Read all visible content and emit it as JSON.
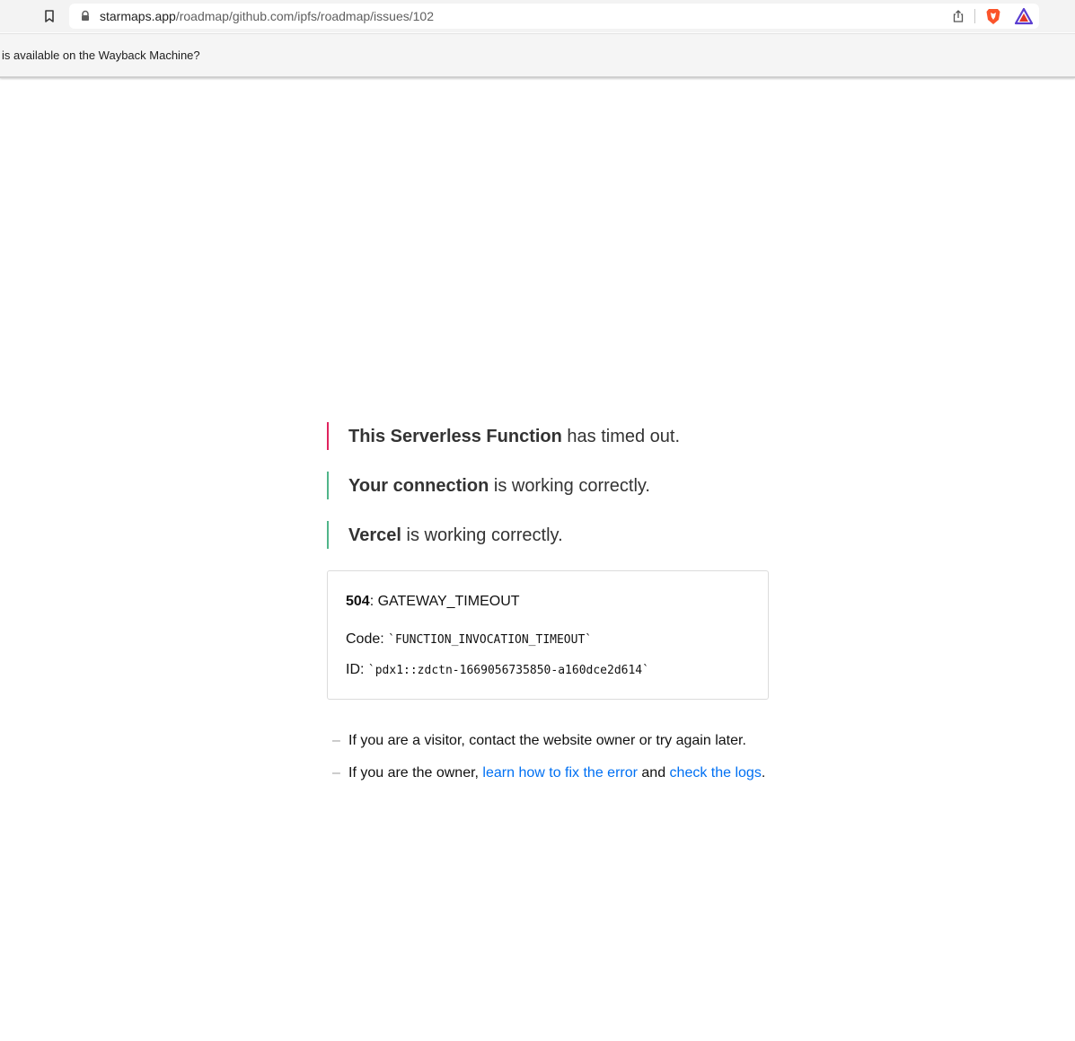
{
  "browser": {
    "url_host": "starmaps.app",
    "url_path": "/roadmap/github.com/ipfs/roadmap/issues/102",
    "icons": [
      "bookmark-icon",
      "lock-icon",
      "share-icon",
      "brave-shields-icon",
      "brave-rewards-icon"
    ],
    "colors": {
      "brave_orange": "#fb542b",
      "rewards_purple": "#5a3dd0",
      "rewards_red": "#e2352a"
    }
  },
  "infobar": {
    "text": "is available on the Wayback Machine?"
  },
  "error_page": {
    "statuses": [
      {
        "bold": "This Serverless Function",
        "rest": " has timed out.",
        "color": "#e0245e"
      },
      {
        "bold": "Your connection",
        "rest": " is working correctly.",
        "color": "#50b58a"
      },
      {
        "bold": "Vercel",
        "rest": " is working correctly.",
        "color": "#50b58a"
      }
    ],
    "error": {
      "code_number": "504",
      "code_name": ": GATEWAY_TIMEOUT",
      "code_label": "Code: ",
      "code_value": "`FUNCTION_INVOCATION_TIMEOUT`",
      "id_label": "ID: ",
      "id_value": "`pdx1::zdctn-1669056735850-a160dce2d614`"
    },
    "help": {
      "dash": "–",
      "visitor_text": "If you are a visitor, contact the website owner or try again later.",
      "owner_prefix": "If you are the owner, ",
      "fix_link": "learn how to fix the error",
      "middle": " and ",
      "logs_link": "check the logs",
      "suffix": ".",
      "link_color": "#0070f3"
    }
  }
}
